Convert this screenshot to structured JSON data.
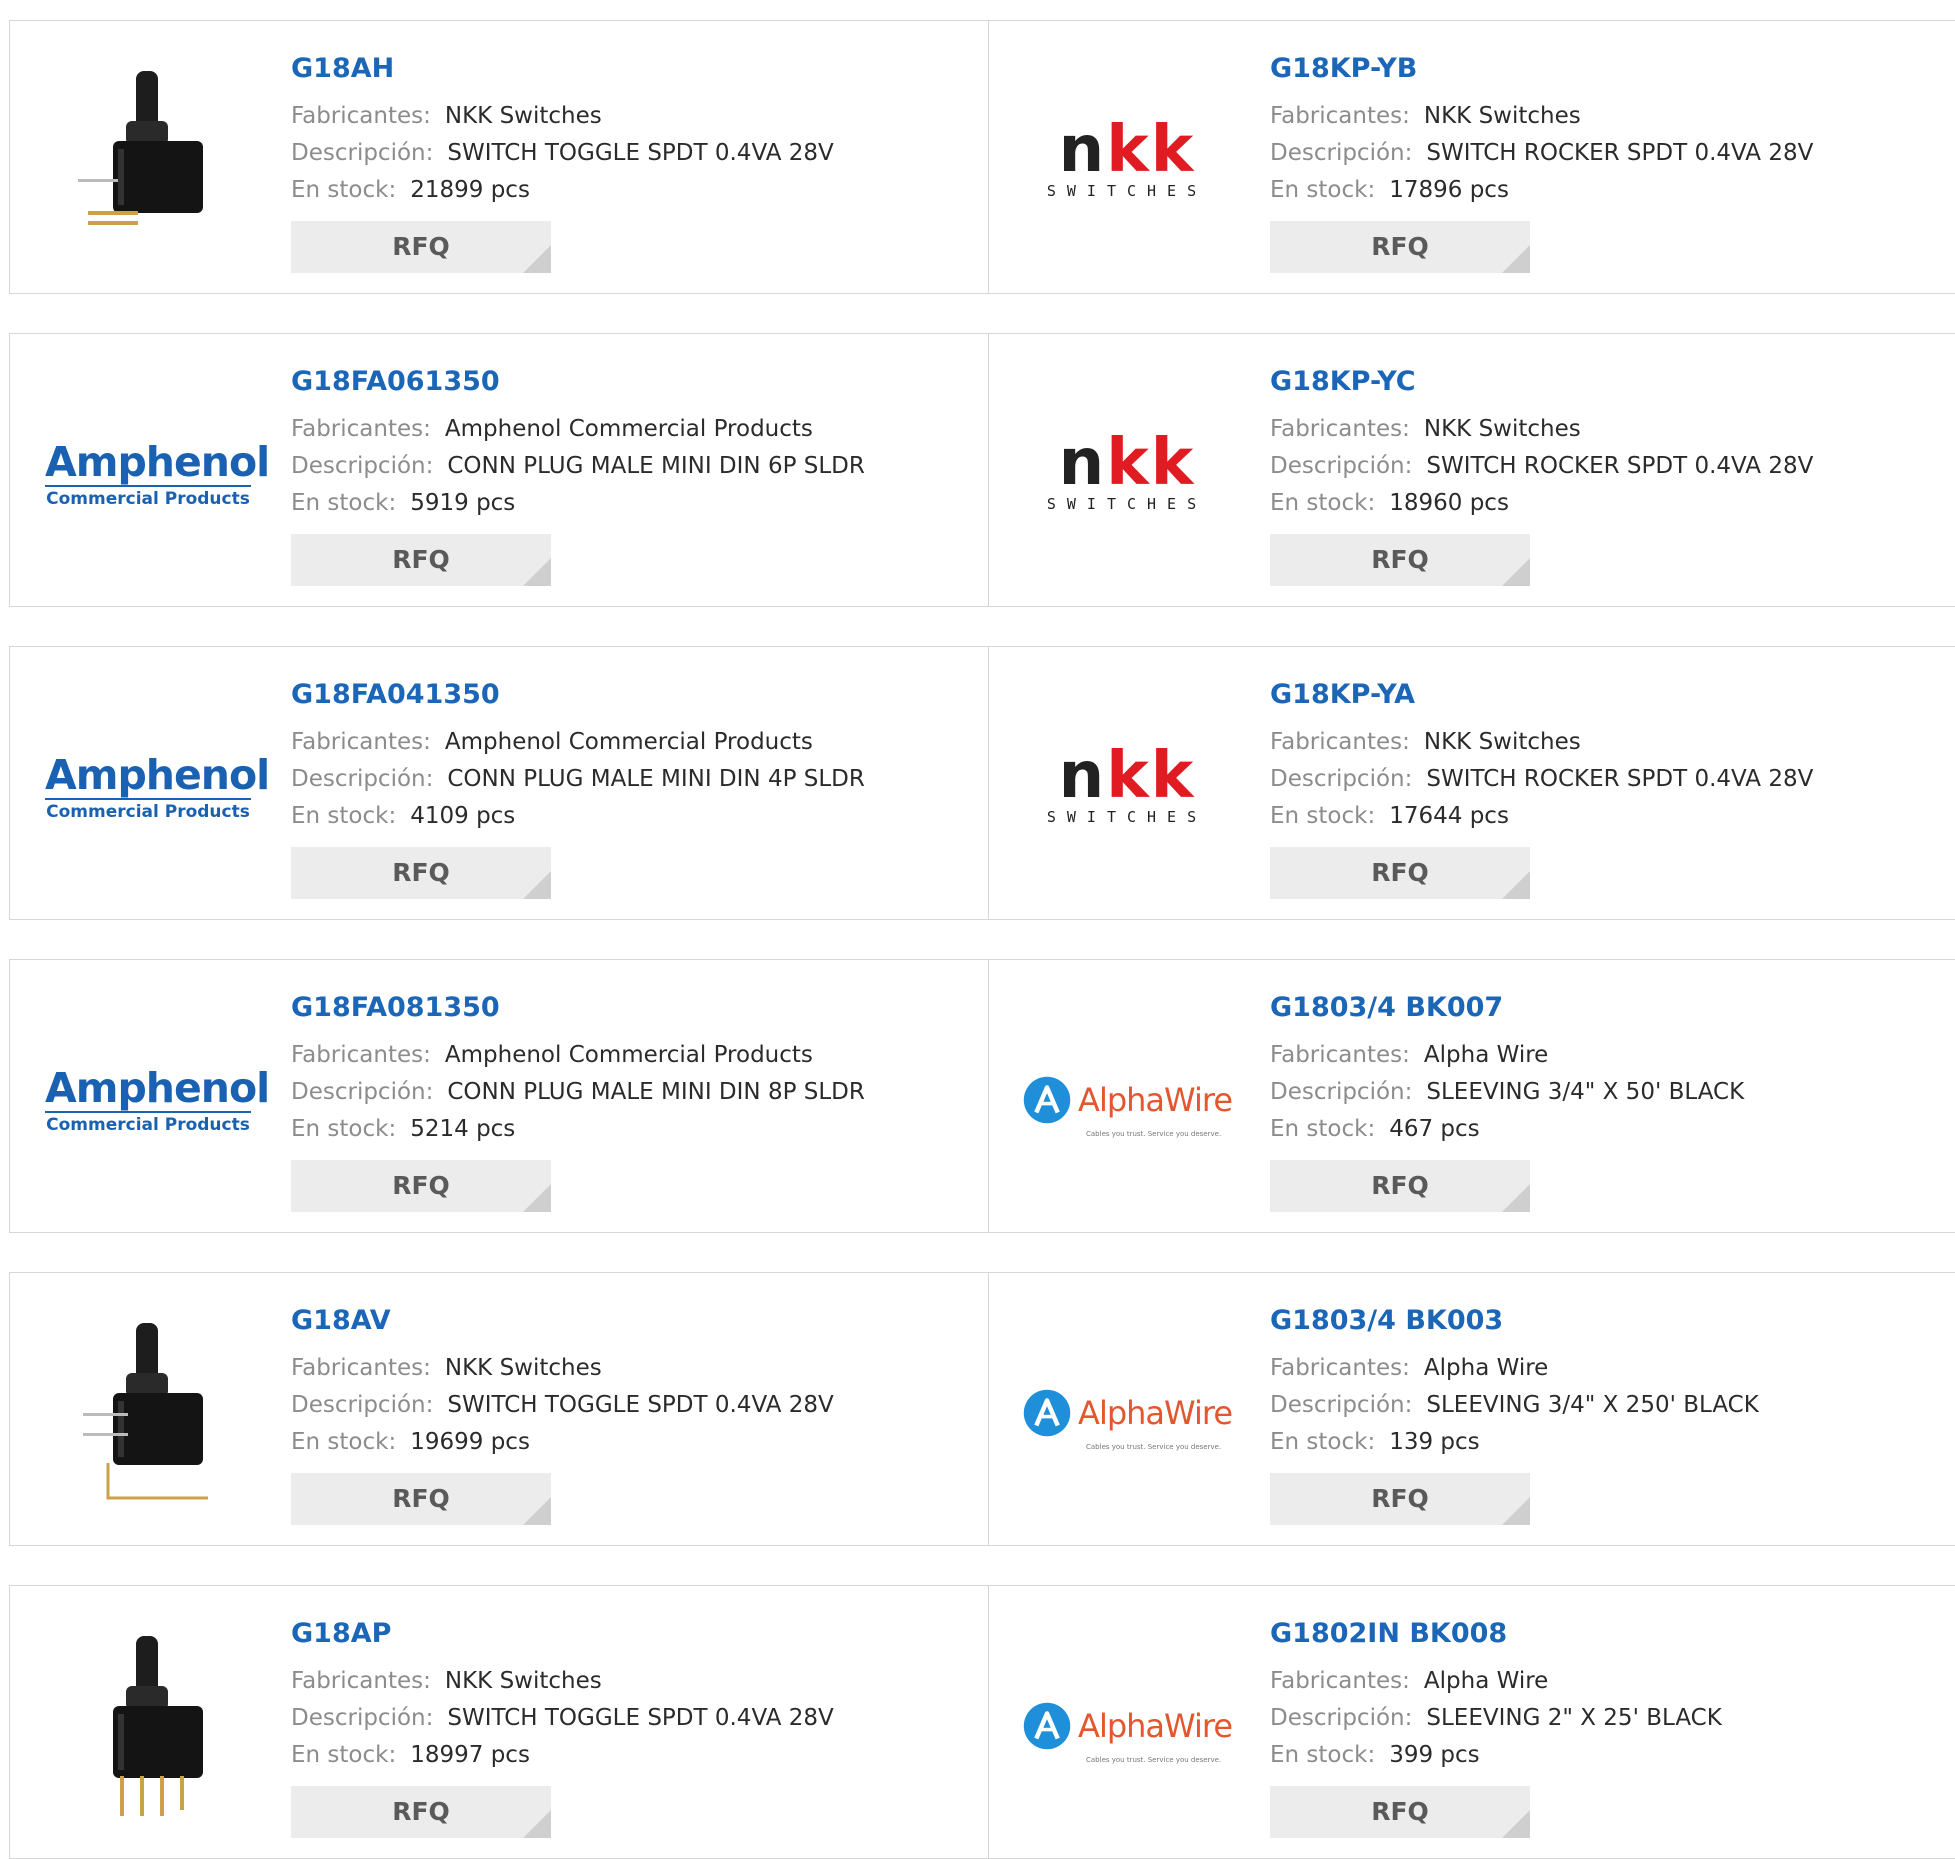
{
  "labels": {
    "manufacturer": "Fabricantes:",
    "description": "Descripción:",
    "stock": "En stock:",
    "rfq": "RFQ"
  },
  "logos": {
    "nkk_text": "NKK",
    "nkk_sub": "SWITCHES",
    "amphenol_main": "Amphenol",
    "amphenol_sub": "Commercial Products",
    "alpha_main": "AlphaWire",
    "alpha_tag": "Cables you trust. Service you deserve."
  },
  "rows": [
    {
      "left": {
        "pn": "G18AH",
        "manufacturer": "NKK Switches",
        "description": "SWITCH TOGGLE SPDT 0.4VA 28V",
        "stock": "21899 pcs",
        "image": "toggle-switch-photo"
      },
      "right": {
        "pn": "G18KP-YB",
        "manufacturer": "NKK Switches",
        "description": "SWITCH ROCKER SPDT 0.4VA 28V",
        "stock": "17896 pcs",
        "image": "nkk-logo"
      }
    },
    {
      "left": {
        "pn": "G18FA061350",
        "manufacturer": "Amphenol Commercial Products",
        "description": "CONN PLUG MALE MINI DIN 6P SLDR",
        "stock": "5919 pcs",
        "image": "amphenol-logo"
      },
      "right": {
        "pn": "G18KP-YC",
        "manufacturer": "NKK Switches",
        "description": "SWITCH ROCKER SPDT 0.4VA 28V",
        "stock": "18960 pcs",
        "image": "nkk-logo"
      }
    },
    {
      "left": {
        "pn": "G18FA041350",
        "manufacturer": "Amphenol Commercial Products",
        "description": "CONN PLUG MALE MINI DIN 4P SLDR",
        "stock": "4109 pcs",
        "image": "amphenol-logo"
      },
      "right": {
        "pn": "G18KP-YA",
        "manufacturer": "NKK Switches",
        "description": "SWITCH ROCKER SPDT 0.4VA 28V",
        "stock": "17644 pcs",
        "image": "nkk-logo"
      }
    },
    {
      "left": {
        "pn": "G18FA081350",
        "manufacturer": "Amphenol Commercial Products",
        "description": "CONN PLUG MALE MINI DIN 8P SLDR",
        "stock": "5214 pcs",
        "image": "amphenol-logo"
      },
      "right": {
        "pn": "G1803/4 BK007",
        "manufacturer": "Alpha Wire",
        "description": "SLEEVING 3/4\" X 50' BLACK",
        "stock": "467 pcs",
        "image": "alphawire-logo"
      }
    },
    {
      "left": {
        "pn": "G18AV",
        "manufacturer": "NKK Switches",
        "description": "SWITCH TOGGLE SPDT 0.4VA 28V",
        "stock": "19699 pcs",
        "image": "toggle-switch-photo-angled"
      },
      "right": {
        "pn": "G1803/4 BK003",
        "manufacturer": "Alpha Wire",
        "description": "SLEEVING 3/4\" X 250' BLACK",
        "stock": "139 pcs",
        "image": "alphawire-logo"
      }
    },
    {
      "left": {
        "pn": "G18AP",
        "manufacturer": "NKK Switches",
        "description": "SWITCH TOGGLE SPDT 0.4VA 28V",
        "stock": "18997 pcs",
        "image": "toggle-switch-photo-pins"
      },
      "right": {
        "pn": "G1802IN BK008",
        "manufacturer": "Alpha Wire",
        "description": "SLEEVING 2\" X 25' BLACK",
        "stock": "399 pcs",
        "image": "alphawire-logo"
      }
    }
  ]
}
